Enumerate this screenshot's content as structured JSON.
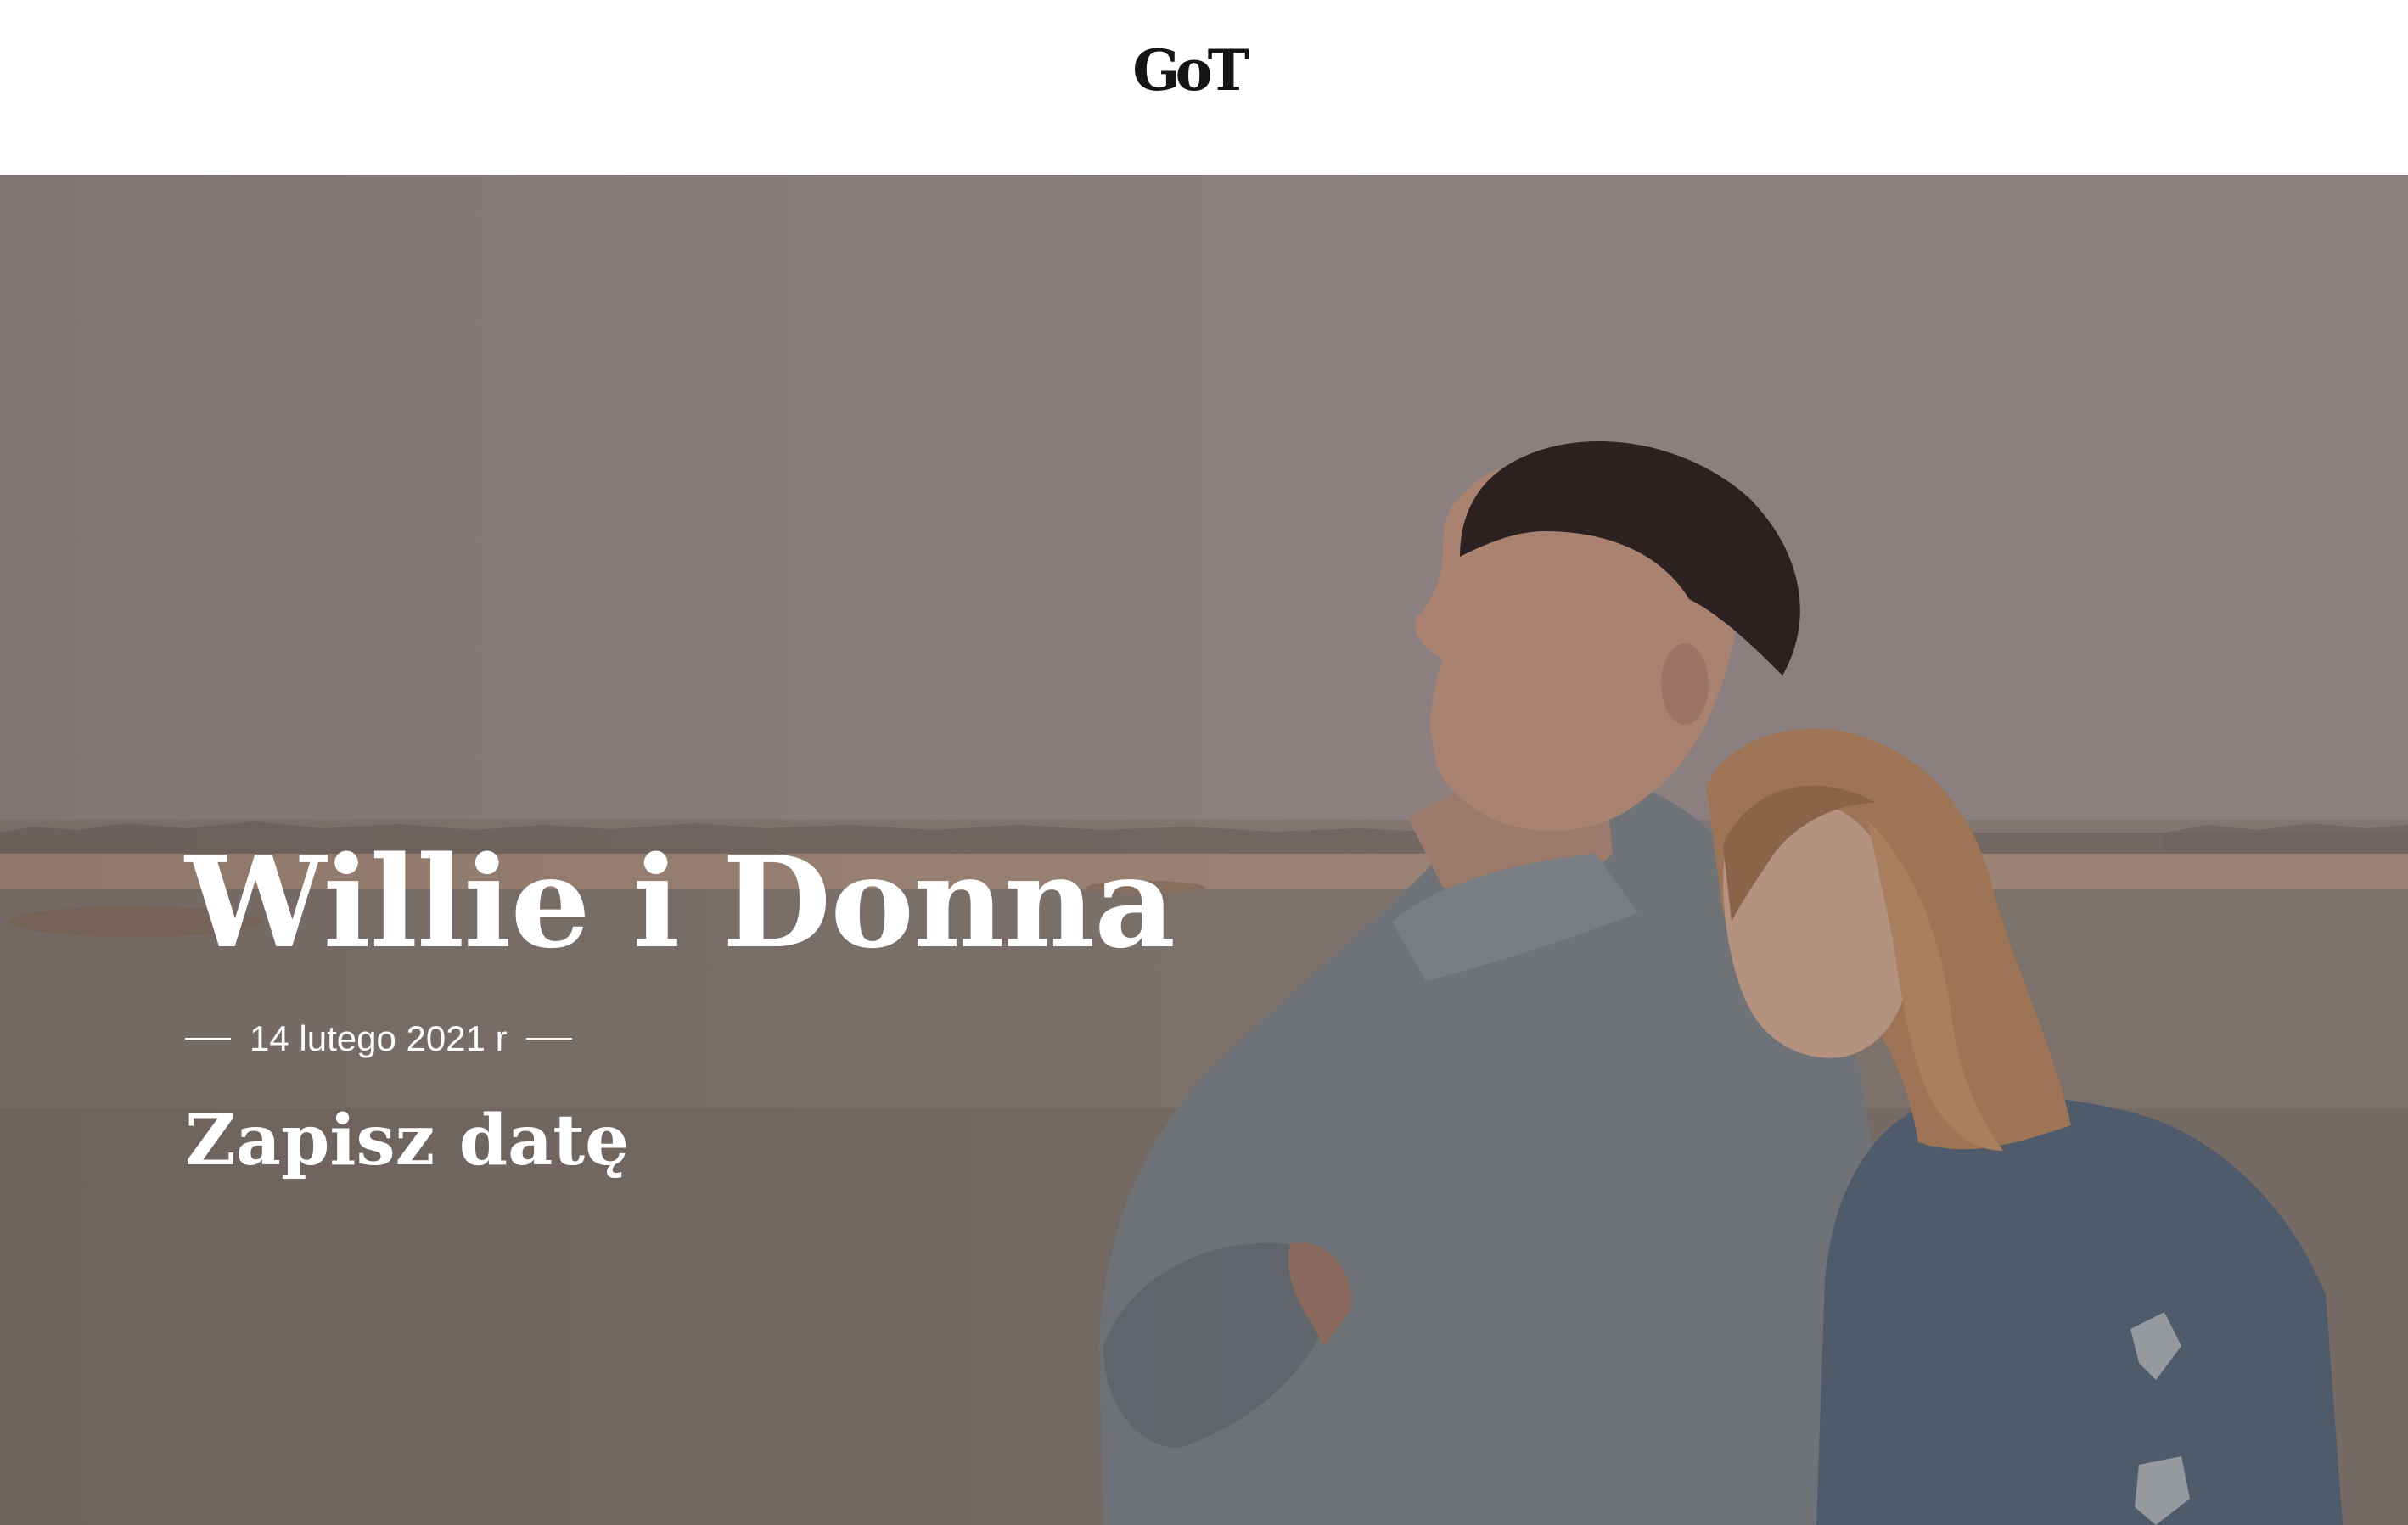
{
  "header": {
    "logo_text": "GoT"
  },
  "hero": {
    "title": "Willie i Donna",
    "date": "14 lutego 2021 r",
    "subtitle": "Zapisz datę",
    "image": "couple-photo-lake"
  }
}
